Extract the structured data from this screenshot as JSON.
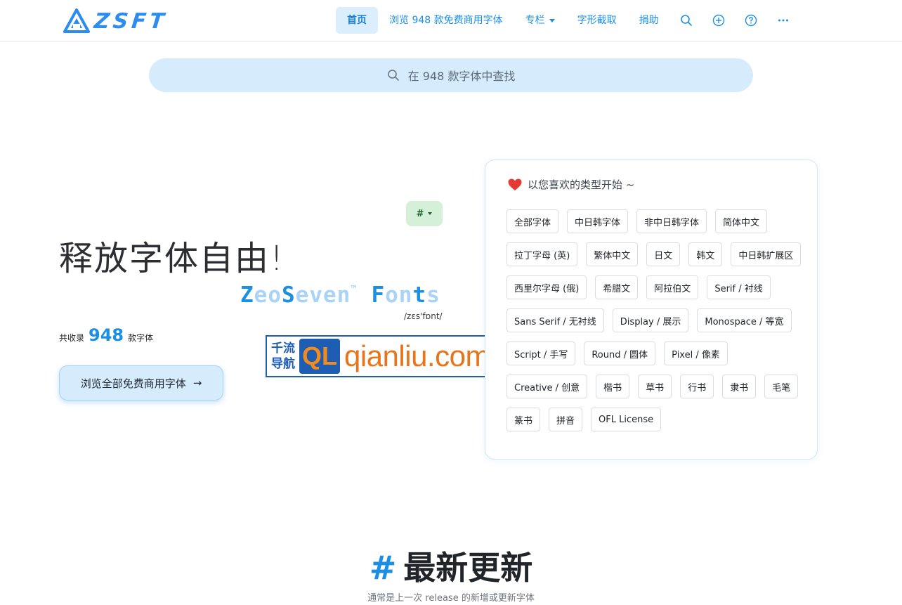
{
  "brand": {
    "logo_text": "ZSFT",
    "primary_color": "#1a8fe3"
  },
  "nav": {
    "items": [
      {
        "label": "首页",
        "active": true
      },
      {
        "label": "浏览 948 款免费商用字体",
        "active": false
      },
      {
        "label": "专栏",
        "active": false,
        "dropdown": true
      },
      {
        "label": "字形截取",
        "active": false
      },
      {
        "label": "捐助",
        "active": false
      }
    ],
    "icons": [
      "search-icon",
      "plus-circle-icon",
      "help-circle-icon",
      "more-icon"
    ]
  },
  "search": {
    "placeholder": "在 948 款字体中查找"
  },
  "hero": {
    "hash_button": "#",
    "title": "释放字体自由!",
    "brand_parts": [
      "Z",
      "eo",
      "S",
      "even",
      "™",
      " ",
      "F",
      "on",
      "t",
      "s"
    ],
    "phonetic": "/zɛs'fɒnt/",
    "count_prefix": "共收录",
    "count": "948",
    "count_suffix": "款字体",
    "browse_label": "浏览全部免费商用字体",
    "browse_arrow": "→"
  },
  "watermark": {
    "line1": "千流",
    "line2": "导航",
    "q": "Q",
    "l": "L",
    "url": "qianliu.com"
  },
  "card": {
    "heading": "以您喜欢的类型开始 ~",
    "tags": [
      "全部字体",
      "中日韩字体",
      "非中日韩字体",
      "简体中文",
      "拉丁字母 (英)",
      "繁体中文",
      "日文",
      "韩文",
      "中日韩扩展区",
      "西里尔字母 (俄)",
      "希腊文",
      "阿拉伯文",
      "Serif / 衬线",
      "Sans Serif / 无衬线",
      "Display / 展示",
      "Monospace / 等宽",
      "Script / 手写",
      "Round / 圆体",
      "Pixel / 像素",
      "Creative / 创意",
      "楷书",
      "草书",
      "行书",
      "隶书",
      "毛笔",
      "篆书",
      "拼音",
      "OFL License"
    ]
  },
  "section": {
    "hash": "#",
    "title": "最新更新",
    "subtitle": "通常是上一次 release 的新增或更新字体"
  }
}
